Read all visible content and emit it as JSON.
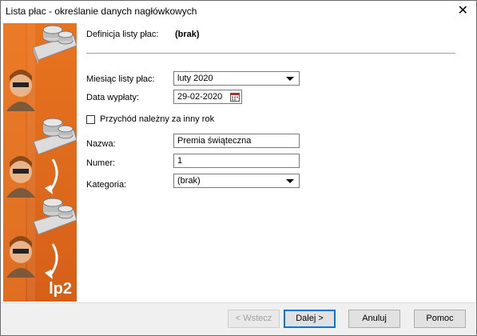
{
  "window": {
    "title": "Lista płac - określanie danych nagłówkowych"
  },
  "sidebar": {
    "logo_text": "lp2"
  },
  "form": {
    "definition_label": "Definicja listy płac:",
    "definition_value": "(brak)",
    "month_label": "Miesiąc listy płac:",
    "month_value": "luty 2020",
    "payment_date_label": "Data wypłaty:",
    "payment_date_value": "29-02-2020",
    "other_year_label": "Przychód należny za inny rok",
    "other_year_checked": false,
    "name_label": "Nazwa:",
    "name_value": "Premia świąteczna",
    "number_label": "Numer:",
    "number_value": "1",
    "category_label": "Kategoria:",
    "category_value": "(brak)"
  },
  "buttons": {
    "back": "< Wstecz",
    "next": "Dalej >",
    "cancel": "Anuluj",
    "help": "Pomoc"
  }
}
